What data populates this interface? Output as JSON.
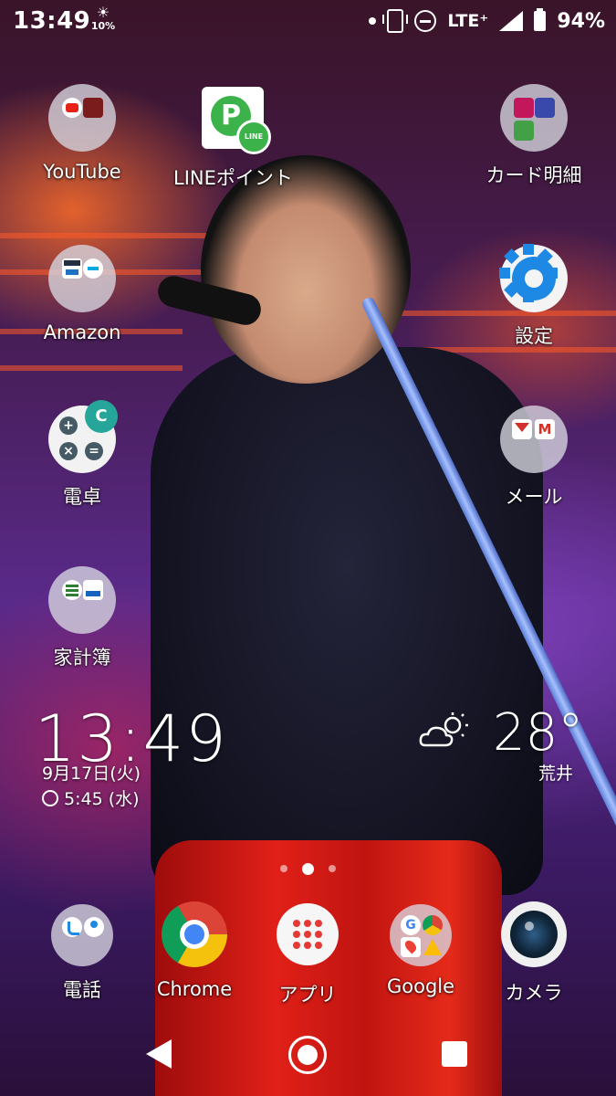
{
  "status_bar": {
    "time": "13:49",
    "weather_percent": "10%",
    "network": "LTE⁺",
    "battery": "94%"
  },
  "apps": {
    "youtube": "YouTube",
    "line_point": "LINEポイント",
    "line_badge": "LINE",
    "card_statement": "カード明細",
    "amazon": "Amazon",
    "settings": "設定",
    "calculator": "電卓",
    "mail": "メール",
    "household": "家計簿"
  },
  "clock_widget": {
    "time": "13:49",
    "date": "9月17日(火)",
    "alarm": "5:45 (水)"
  },
  "weather_widget": {
    "temperature": "28°",
    "location": "荒井"
  },
  "dock": {
    "phone": "電話",
    "chrome": "Chrome",
    "apps": "アプリ",
    "google": "Google",
    "camera": "カメラ"
  },
  "page_indicator": {
    "pages": 3,
    "current": 2
  },
  "colors": {
    "line_green": "#3cb34a",
    "settings_blue": "#1e88e5",
    "apps_red": "#e53935"
  }
}
